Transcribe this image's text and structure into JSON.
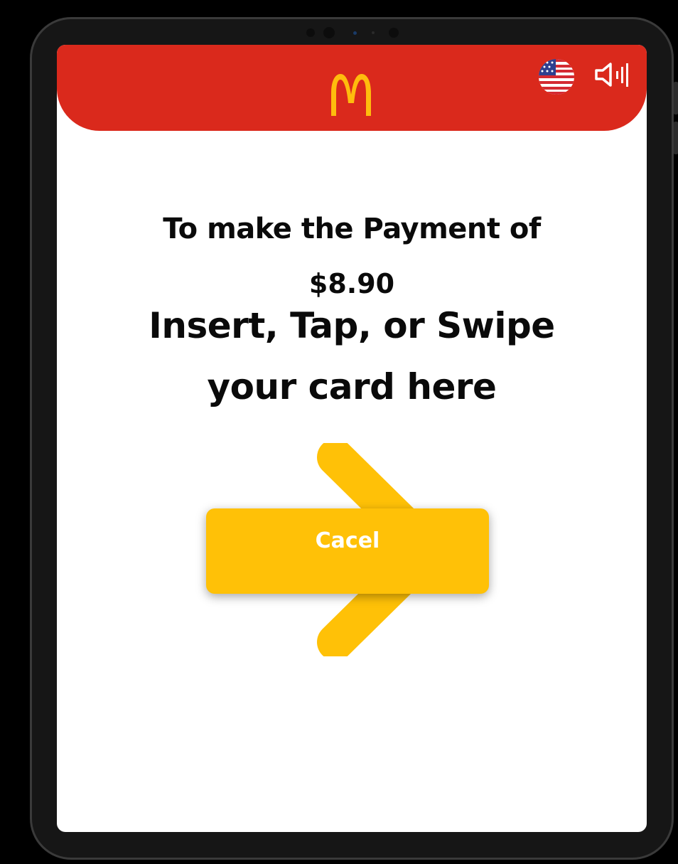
{
  "colors": {
    "header_red": "#DA291C",
    "brand_yellow": "#FFC107",
    "arch_yellow": "#FFBC0D",
    "text_dark": "#0A0A0A",
    "button_text": "#FFFFFF"
  },
  "header": {
    "logo_icon": "golden-arches-logo",
    "language_icon": "us-flag-icon",
    "sound_icon": "speaker-icon"
  },
  "payment": {
    "line1": "To make the Payment of",
    "amount": "$8.90",
    "line3": "Insert, Tap, or Swipe",
    "line4": "your card here",
    "direction_icon": "arrow-right-icon"
  },
  "actions": {
    "cancel_label": "Cacel"
  }
}
